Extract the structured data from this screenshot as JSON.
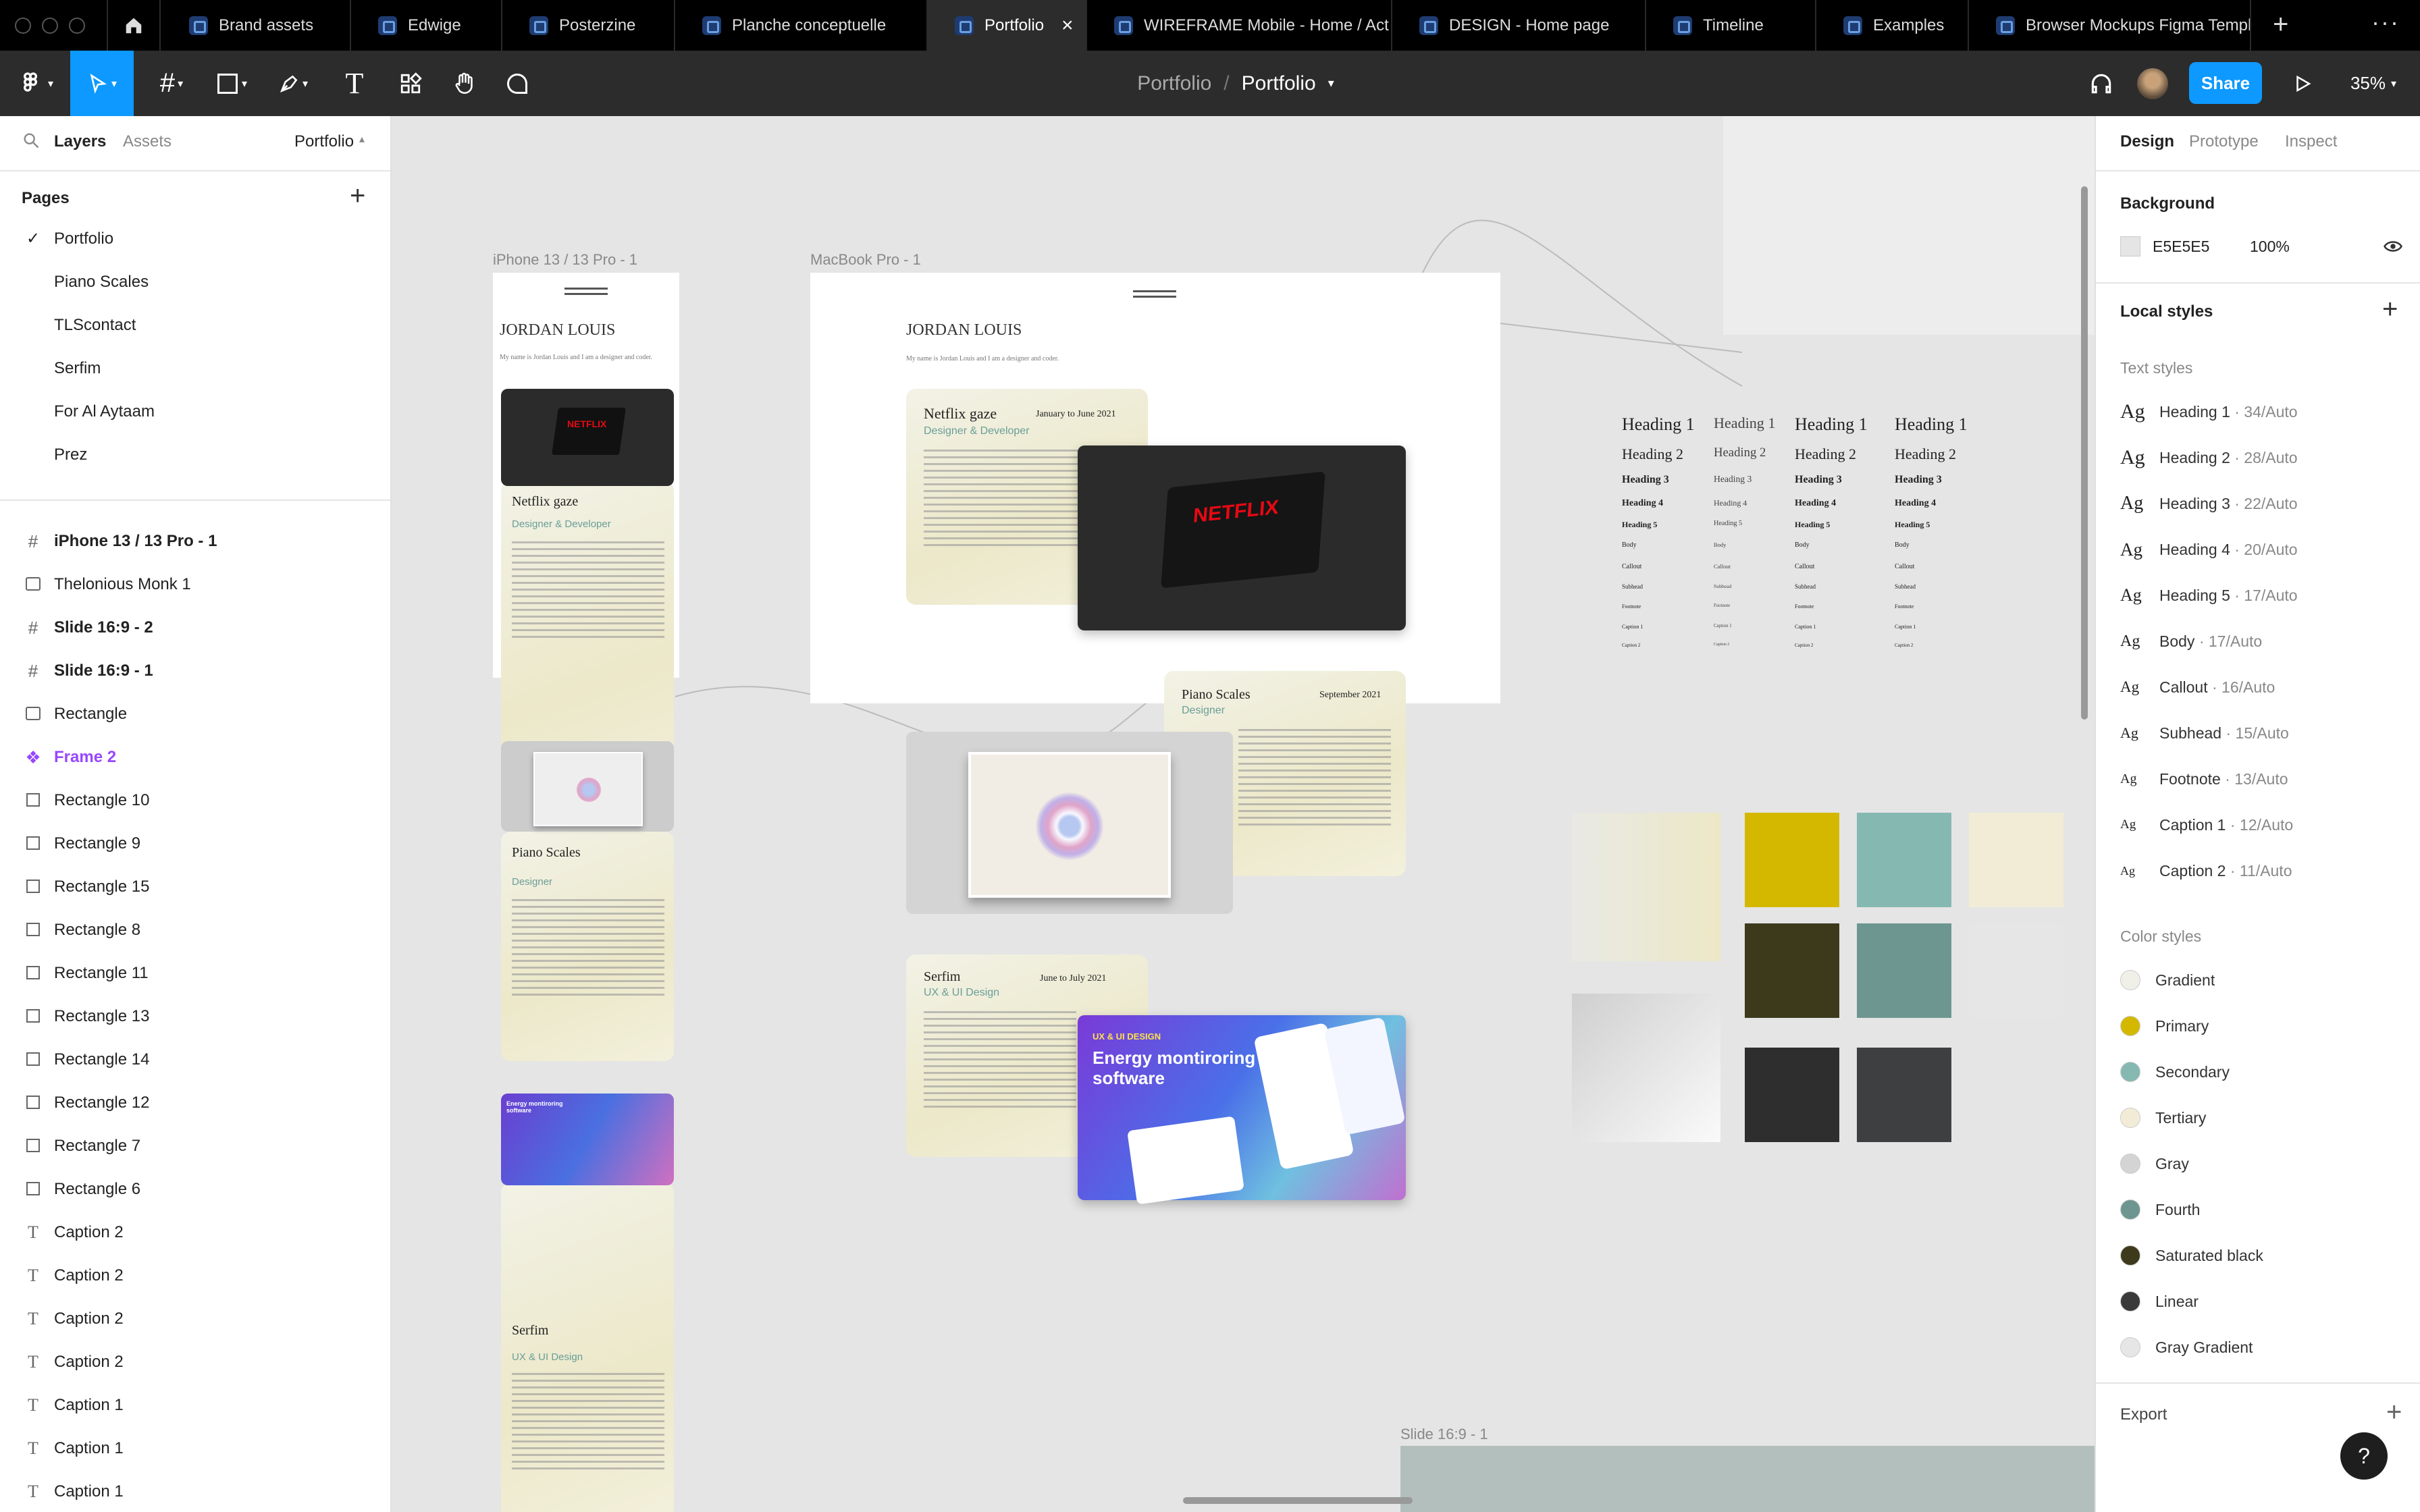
{
  "tabs": [
    {
      "label": "Brand assets"
    },
    {
      "label": "Edwige"
    },
    {
      "label": "Posterzine"
    },
    {
      "label": "Planche conceptuelle"
    },
    {
      "label": "Portfolio",
      "close": "×"
    },
    {
      "label": "WIREFRAME Mobile - Home / Act"
    },
    {
      "label": "DESIGN - Home page"
    },
    {
      "label": "Timeline"
    },
    {
      "label": "Examples"
    },
    {
      "label": "Browser Mockups Figma Templa"
    }
  ],
  "toolbar": {
    "breadcrumb_project": "Portfolio",
    "breadcrumb_sep": "/",
    "breadcrumb_file": "Portfolio",
    "share": "Share",
    "zoom": "35%"
  },
  "left": {
    "tab_layers": "Layers",
    "tab_assets": "Assets",
    "page_selector": "Portfolio",
    "pages_title": "Pages",
    "pages": [
      "Portfolio",
      "Piano Scales",
      "TLScontact",
      "Serfim",
      "For Al Aytaam",
      "Prez"
    ],
    "layers": [
      {
        "label": "iPhone 13 / 13 Pro - 1",
        "icon": "#"
      },
      {
        "label": "Thelonious Monk 1",
        "icon": "img"
      },
      {
        "label": "Slide 16:9 - 2",
        "icon": "#"
      },
      {
        "label": "Slide 16:9 - 1",
        "icon": "#"
      },
      {
        "label": "Rectangle",
        "icon": "img"
      },
      {
        "label": "Frame 2",
        "icon": "component"
      },
      {
        "label": "Rectangle 10",
        "icon": "rect"
      },
      {
        "label": "Rectangle 9",
        "icon": "rect"
      },
      {
        "label": "Rectangle 15",
        "icon": "rect"
      },
      {
        "label": "Rectangle 8",
        "icon": "rect"
      },
      {
        "label": "Rectangle 11",
        "icon": "rect"
      },
      {
        "label": "Rectangle 13",
        "icon": "rect"
      },
      {
        "label": "Rectangle 14",
        "icon": "rect"
      },
      {
        "label": "Rectangle 12",
        "icon": "rect"
      },
      {
        "label": "Rectangle 7",
        "icon": "rect"
      },
      {
        "label": "Rectangle 6",
        "icon": "rect"
      },
      {
        "label": "Caption 2",
        "icon": "T"
      },
      {
        "label": "Caption 2",
        "icon": "T"
      },
      {
        "label": "Caption 2",
        "icon": "T"
      },
      {
        "label": "Caption 2",
        "icon": "T"
      },
      {
        "label": "Caption 1",
        "icon": "T"
      },
      {
        "label": "Caption 1",
        "icon": "T"
      },
      {
        "label": "Caption 1",
        "icon": "T"
      }
    ]
  },
  "right": {
    "tabs": [
      "Design",
      "Prototype",
      "Inspect"
    ],
    "background_title": "Background",
    "bg_hex": "E5E5E5",
    "bg_opacity": "100%",
    "local_styles": "Local styles",
    "text_styles": "Text styles",
    "text_style_items": [
      {
        "ag": "Ag",
        "name": "Heading 1",
        "spec": " · 34/Auto"
      },
      {
        "ag": "Ag",
        "name": "Heading 2",
        "spec": " · 28/Auto"
      },
      {
        "ag": "Ag",
        "name": "Heading 3",
        "spec": " · 22/Auto"
      },
      {
        "ag": "Ag",
        "name": "Heading 4",
        "spec": " · 20/Auto"
      },
      {
        "ag": "Ag",
        "name": "Heading 5",
        "spec": " · 17/Auto"
      },
      {
        "ag": "Ag",
        "name": "Body",
        "spec": " · 17/Auto"
      },
      {
        "ag": "Ag",
        "name": "Callout",
        "spec": " · 16/Auto"
      },
      {
        "ag": "Ag",
        "name": "Subhead",
        "spec": " · 15/Auto"
      },
      {
        "ag": "Ag",
        "name": "Footnote",
        "spec": " · 13/Auto"
      },
      {
        "ag": "Ag",
        "name": "Caption 1",
        "spec": " · 12/Auto"
      },
      {
        "ag": "Ag",
        "name": "Caption 2",
        "spec": " · 11/Auto"
      }
    ],
    "color_styles": "Color styles",
    "color_items": [
      {
        "name": "Gradient",
        "color": "#f0efe8"
      },
      {
        "name": "Primary",
        "color": "#d4b800"
      },
      {
        "name": "Secondary",
        "color": "#86b8b2"
      },
      {
        "name": "Tertiary",
        "color": "#f2ecd6"
      },
      {
        "name": "Gray",
        "color": "#d4d4d4"
      },
      {
        "name": "Fourth",
        "color": "#6e9690"
      },
      {
        "name": "Saturated black",
        "color": "#3d3a1c"
      },
      {
        "name": "Linear",
        "color": "#3a3a3a"
      },
      {
        "name": "Gray Gradient",
        "color": "#e6e6e6"
      }
    ],
    "export": "Export",
    "help": "?"
  },
  "canvas": {
    "iphone_label": "iPhone 13 / 13 Pro - 1",
    "macbook_label": "MacBook Pro - 1",
    "slide_label": "Slide 16:9 - 1",
    "name": "JORDAN LOUIS",
    "intro": "My name is Jordan Louis and I am a designer and coder.",
    "projects": [
      {
        "title": "Netflix gaze",
        "date": "January to June 2021",
        "role": "Designer & Developer"
      },
      {
        "title": "Piano Scales",
        "date": "September 2021",
        "role": "Designer"
      },
      {
        "title": "Serfim",
        "date": "June to July 2021",
        "role": "UX & UI Design"
      }
    ],
    "netflix": "NETFLIX",
    "energy_tag": "UX & UI DESIGN",
    "energy_title": "Energy montiroring software",
    "type_specimens": [
      [
        "Heading 1",
        "Heading 2",
        "Heading 3",
        "Heading 4",
        "Heading 5",
        "Body",
        "Callout",
        "Subhead",
        "Footnote",
        "Caption 1",
        "Caption 2"
      ]
    ],
    "swatches": [
      "#e9e8dc",
      "#d4b800",
      "#86b8b2",
      "#f2ecd6",
      "#3d3a1c",
      "#6e9690",
      "#d4d4d4",
      "#e6e6e6",
      "#2e2e2e",
      "#3d3f41"
    ]
  },
  "icons": {
    "home": "home-icon",
    "move": "move-icon",
    "frame": "frame-icon",
    "shape": "rectangle-icon",
    "pen": "pen-icon",
    "text": "text-icon",
    "components": "components-icon",
    "hand": "hand-icon",
    "comment": "comment-icon",
    "headphones": "headphones-icon",
    "play": "play-icon",
    "search": "search-icon",
    "eye": "eye-icon",
    "plus": "plus-icon",
    "more": "more-icon"
  }
}
